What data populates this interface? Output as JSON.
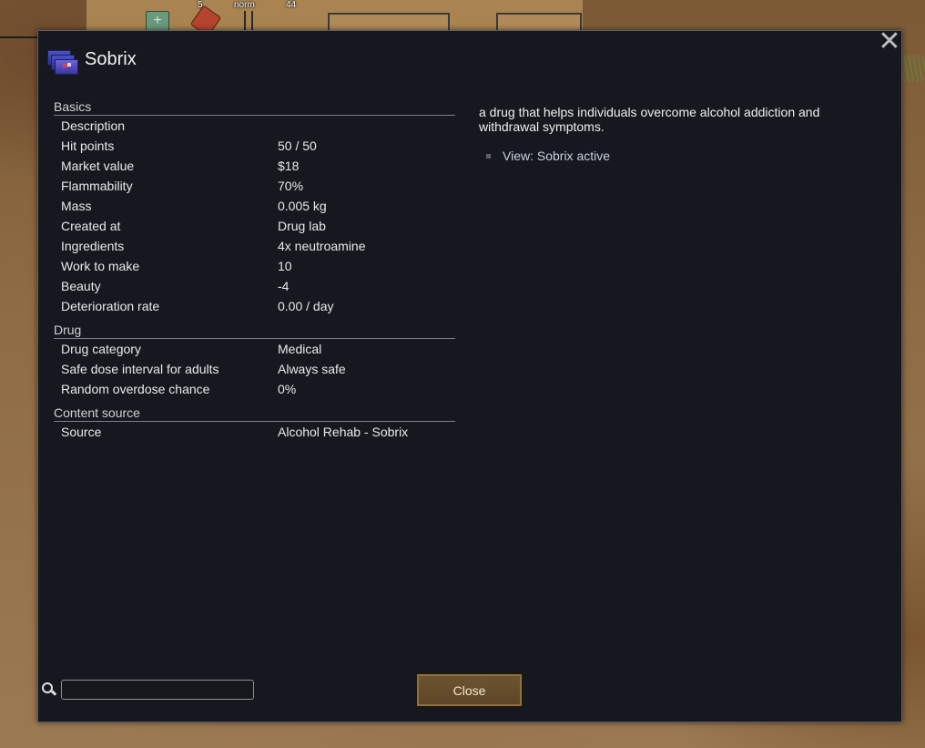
{
  "hud": {
    "num_a": "5",
    "num_b": "norm",
    "num_c": "44"
  },
  "dialog": {
    "title": "Sobrix",
    "title_icon": "sobrix-item-icon",
    "close_icon": "close-x-icon"
  },
  "stats": {
    "basics": {
      "heading": "Basics",
      "rows": [
        {
          "label": "Description",
          "value": ""
        },
        {
          "label": "Hit points",
          "value": "50 / 50"
        },
        {
          "label": "Market value",
          "value": "$18"
        },
        {
          "label": "Flammability",
          "value": "70%"
        },
        {
          "label": "Mass",
          "value": "0.005 kg"
        },
        {
          "label": "Created at",
          "value": "Drug lab"
        },
        {
          "label": "Ingredients",
          "value": "4x neutroamine"
        },
        {
          "label": "Work to make",
          "value": "10"
        },
        {
          "label": "Beauty",
          "value": "-4"
        },
        {
          "label": "Deterioration rate",
          "value": "0.00 / day"
        }
      ]
    },
    "drug": {
      "heading": "Drug",
      "rows": [
        {
          "label": "Drug category",
          "value": "Medical"
        },
        {
          "label": "Safe dose interval for adults",
          "value": "Always safe"
        },
        {
          "label": "Random overdose chance",
          "value": "0%"
        }
      ]
    },
    "content_source": {
      "heading": "Content source",
      "rows": [
        {
          "label": "Source",
          "value": "Alcohol Rehab - Sobrix"
        }
      ]
    }
  },
  "detail": {
    "description": "a drug that helps individuals overcome alcohol addiction and withdrawal symptoms.",
    "link_label": "View: Sobrix active"
  },
  "footer": {
    "search_value": "",
    "search_placeholder": "",
    "close_label": "Close"
  },
  "colors": {
    "dialog_bg": "#15191f",
    "button_bg": "#6e5531",
    "link": "#c7cfe0"
  }
}
